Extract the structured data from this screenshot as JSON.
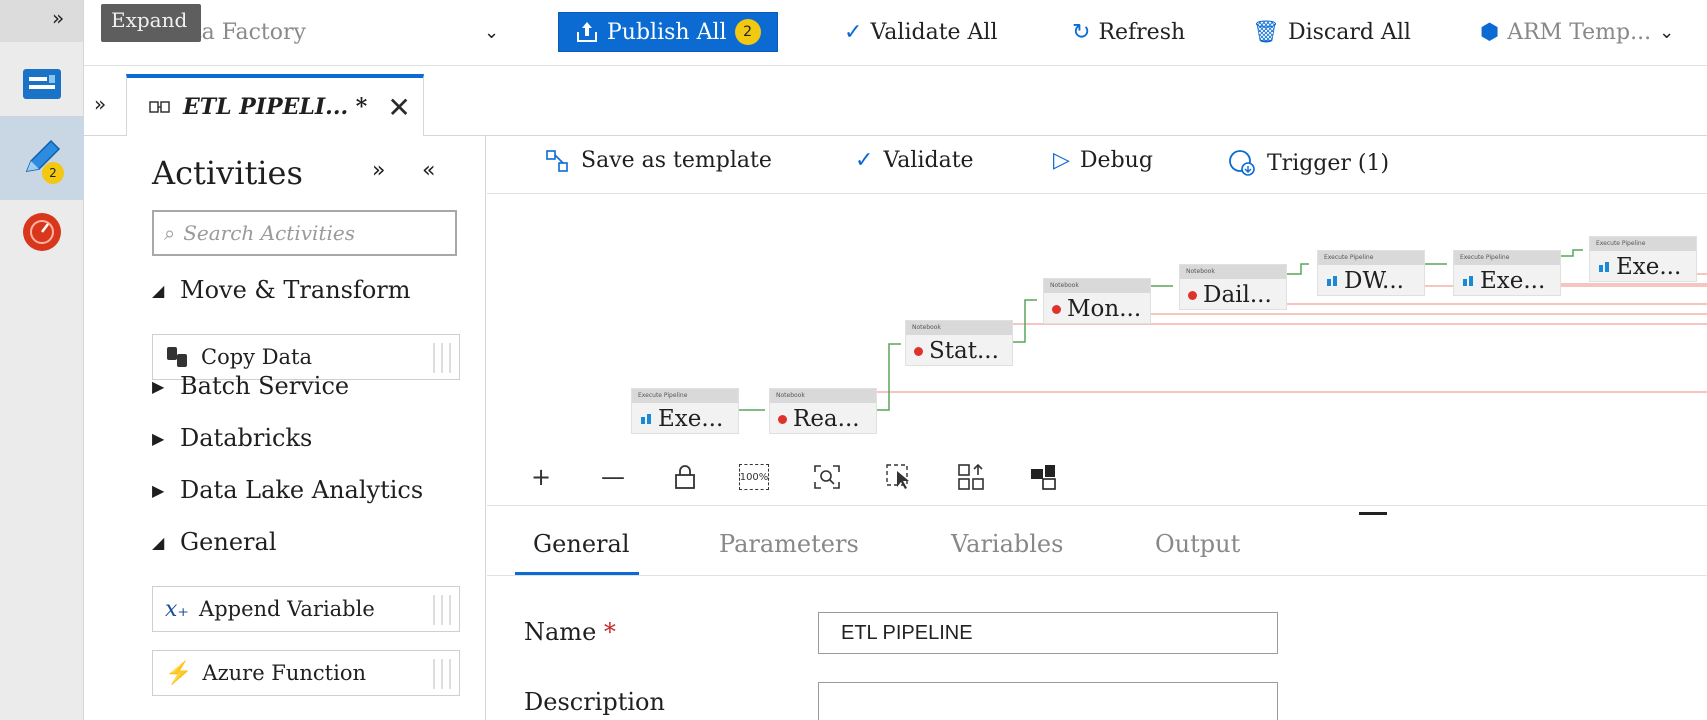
{
  "rail": {
    "expand_glyph": "»",
    "author_badge": "2"
  },
  "tooltip": "Expand",
  "topbar": {
    "factory": "Data Factory",
    "publish": "Publish All",
    "publish_count": "2",
    "validate_all": "Validate All",
    "refresh": "Refresh",
    "discard_all": "Discard All",
    "arm": "ARM Temp..."
  },
  "tab": {
    "expand_glyph": "»",
    "title": "ETL PIPELI... *",
    "close": "✕"
  },
  "activities": {
    "title": "Activities",
    "search_placeholder": "Search Activities",
    "categories": [
      {
        "label": "Move & Transform",
        "tri": "◢"
      },
      {
        "label": "Batch Service",
        "tri": "▶"
      },
      {
        "label": "Databricks",
        "tri": "▶"
      },
      {
        "label": "Data Lake Analytics",
        "tri": "▶"
      },
      {
        "label": "General",
        "tri": "◢"
      }
    ],
    "items": [
      {
        "label": "Copy Data"
      },
      {
        "label": "Append Variable"
      },
      {
        "label": "Azure Function"
      }
    ]
  },
  "canvas_toolbar": {
    "save_template": "Save as template",
    "validate": "Validate",
    "debug": "Debug",
    "trigger": "Trigger (1)"
  },
  "nodes": [
    {
      "type": "Execute Pipeline",
      "label": "Exe..."
    },
    {
      "type": "Notebook",
      "label": "Rea..."
    },
    {
      "type": "Notebook",
      "label": "Stat..."
    },
    {
      "type": "Notebook",
      "label": "Mon..."
    },
    {
      "type": "Notebook",
      "label": "Dail..."
    },
    {
      "type": "Execute Pipeline",
      "label": "DW..."
    },
    {
      "type": "Execute Pipeline",
      "label": "Exe..."
    },
    {
      "type": "Execute Pipeline",
      "label": "Exe..."
    }
  ],
  "zoom": {
    "plus": "+",
    "minus": "—",
    "fit": "100%"
  },
  "props": {
    "tabs": [
      "General",
      "Parameters",
      "Variables",
      "Output"
    ],
    "name_label": "Name",
    "required_mark": "*",
    "name_value": "ETL PIPELINE",
    "description_label": "Description",
    "description_value": ""
  },
  "colors": {
    "accent": "#0b6bd3",
    "badge": "#f2c811",
    "success_link": "#5aa55a",
    "fail_link": "#f4b3a8"
  }
}
